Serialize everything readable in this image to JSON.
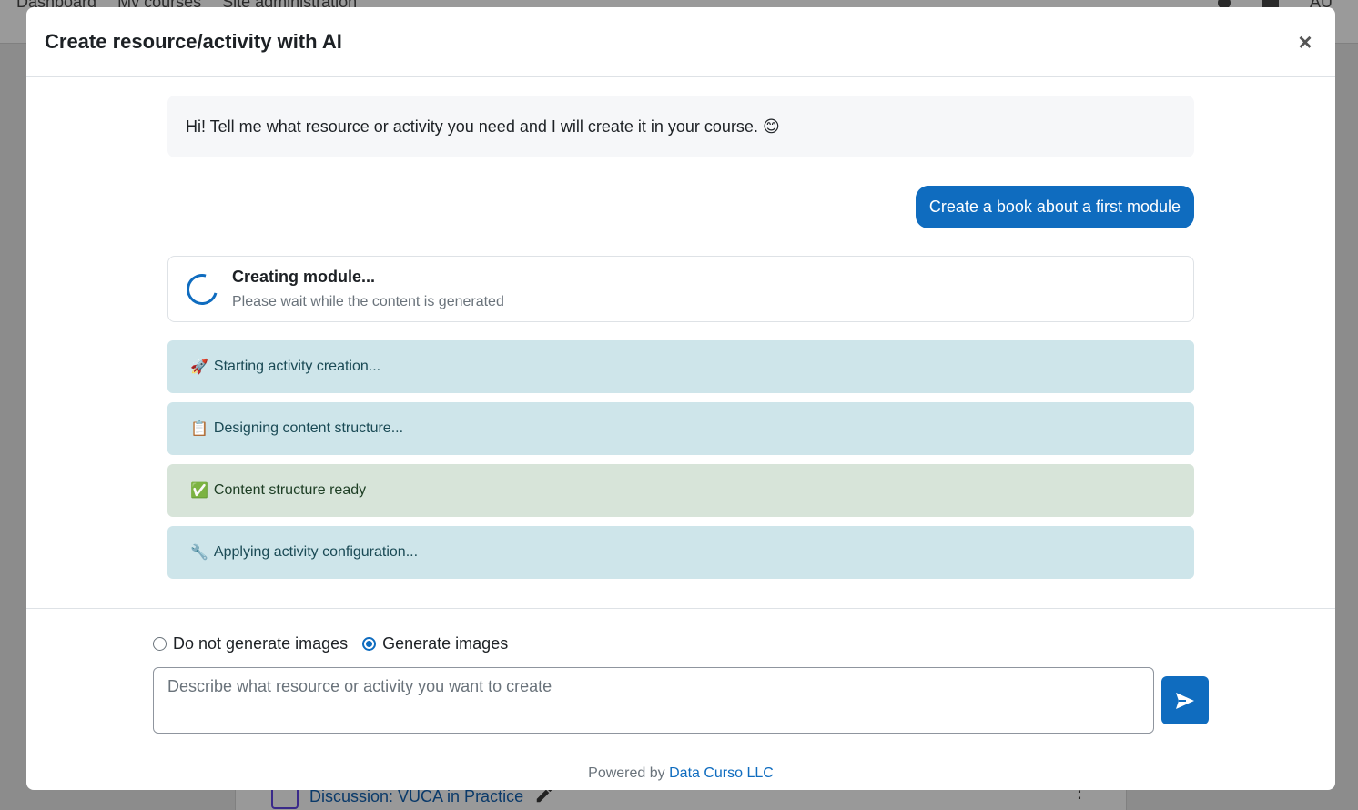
{
  "background": {
    "nav_links": [
      "Dashboard",
      "My courses",
      "Site administration"
    ],
    "user_initials": "AU",
    "activity_title": "Discussion: VUCA in Practice"
  },
  "modal": {
    "title": "Create resource/activity with AI",
    "close_label": "×"
  },
  "chat": {
    "bot_greeting": "Hi! Tell me what resource or activity you need and I will create it in your course. 😊",
    "user_message": "Create a book about a first module",
    "progress": {
      "title": "Creating module...",
      "subtitle": "Please wait while the content is generated"
    },
    "status_steps": [
      {
        "emoji": "🚀",
        "text": "Starting activity creation...",
        "kind": "info"
      },
      {
        "emoji": "📋",
        "text": "Designing content structure...",
        "kind": "info"
      },
      {
        "emoji": "✅",
        "text": "Content structure ready",
        "kind": "success"
      },
      {
        "emoji": "🔧",
        "text": "Applying activity configuration...",
        "kind": "info"
      }
    ]
  },
  "footer": {
    "image_options": [
      {
        "label": "Do not generate images",
        "selected": false
      },
      {
        "label": "Generate images",
        "selected": true
      }
    ],
    "prompt_placeholder": "Describe what resource or activity you want to create",
    "prompt_value": "",
    "powered_prefix": "Powered by",
    "powered_link": "Data Curso LLC"
  },
  "colors": {
    "primary": "#0f6cbf",
    "info_bg": "#cee5ea",
    "success_bg": "#d7e4d9"
  }
}
